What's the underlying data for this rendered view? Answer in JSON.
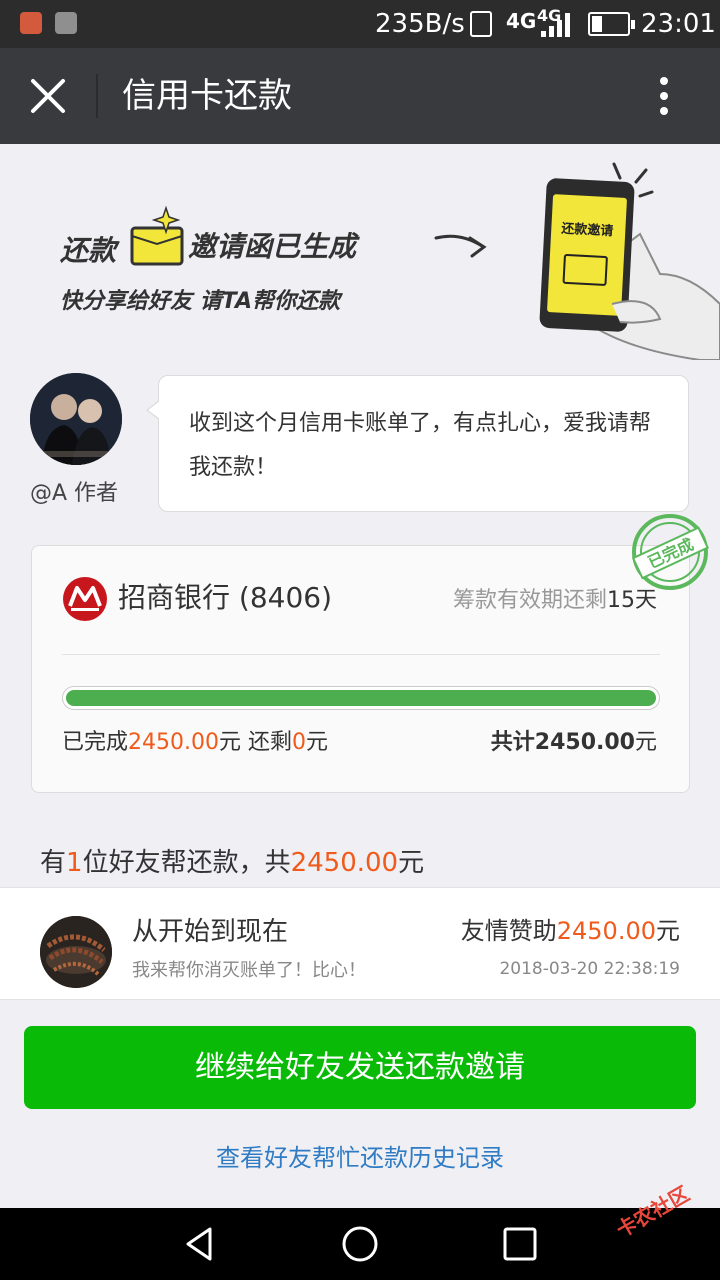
{
  "status_bar": {
    "net_speed": "235B/s",
    "network_1": "4G",
    "network_2": "4G",
    "time": "23:01",
    "icons": [
      "mail-icon",
      "image-icon",
      "vibrate-icon",
      "signal-icon",
      "battery-icon"
    ]
  },
  "nav": {
    "title": "信用卡还款",
    "close_icon": "close-icon",
    "more_icon": "more-vertical-icon"
  },
  "banner": {
    "line1_a": "还款",
    "line1_b": "邀请函已生成",
    "line2": "快分享给好友  请TA帮你还款",
    "phone_text": "还款邀请"
  },
  "author": {
    "name": "@A 作者",
    "message": "收到这个月信用卡账单了，有点扎心，爱我请帮我还款！"
  },
  "card": {
    "bank": "招商银行 (8406)",
    "validity_prefix": "筹款有效期还剩",
    "validity_days": "15天",
    "progress_fraction": 1.0,
    "completed_prefix": "已完成",
    "completed_amount": "2450.00",
    "completed_unit": "元 还剩",
    "remaining_amount": "0",
    "remaining_unit": "元",
    "total_label": "共计2450.00",
    "total_unit": "元",
    "stamp": "已完成"
  },
  "friends": {
    "prefix": "有",
    "count": "1",
    "middle": "位好友帮还款，共",
    "amount": "2450.00",
    "suffix": "元"
  },
  "donor": {
    "name": "从开始到现在",
    "message": "我来帮你消灭账单了！比心！",
    "amount_label": "友情赞助",
    "amount": "2450.00",
    "amount_unit": "元",
    "time": "2018-03-20 22:38:19"
  },
  "actions": {
    "send_label": "继续给好友发送还款邀请",
    "history_label": "查看好友帮忙还款历史记录"
  },
  "watermark": "卡农社区",
  "colors": {
    "accent_green": "#09bb07",
    "progress_green": "#4cae4f",
    "amount_orange": "#f05a1a",
    "link_blue": "#2f7bc4",
    "nav_bg": "#393a3e"
  }
}
